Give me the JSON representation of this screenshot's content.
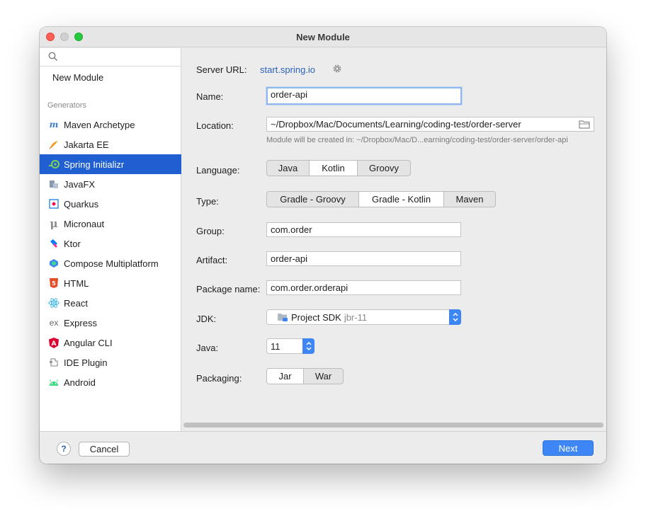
{
  "window": {
    "title": "New Module"
  },
  "sidebar": {
    "search_placeholder": "",
    "new_module": "New Module",
    "generators_label": "Generators",
    "items": [
      {
        "label": "Maven Archetype",
        "icon": "maven-icon",
        "selected": false
      },
      {
        "label": "Jakarta EE",
        "icon": "jakarta-icon",
        "selected": false
      },
      {
        "label": "Spring Initializr",
        "icon": "spring-icon",
        "selected": true
      },
      {
        "label": "JavaFX",
        "icon": "javafx-icon",
        "selected": false
      },
      {
        "label": "Quarkus",
        "icon": "quarkus-icon",
        "selected": false
      },
      {
        "label": "Micronaut",
        "icon": "micronaut-icon",
        "selected": false
      },
      {
        "label": "Ktor",
        "icon": "ktor-icon",
        "selected": false
      },
      {
        "label": "Compose Multiplatform",
        "icon": "compose-icon",
        "selected": false
      },
      {
        "label": "HTML",
        "icon": "html5-icon",
        "selected": false
      },
      {
        "label": "React",
        "icon": "react-icon",
        "selected": false
      },
      {
        "label": "Express",
        "icon": "express-icon",
        "selected": false
      },
      {
        "label": "Angular CLI",
        "icon": "angular-icon",
        "selected": false
      },
      {
        "label": "IDE Plugin",
        "icon": "plugin-icon",
        "selected": false
      },
      {
        "label": "Android",
        "icon": "android-icon",
        "selected": false
      }
    ]
  },
  "form": {
    "server_url_label": "Server URL:",
    "server_url_value": "start.spring.io",
    "name_label": "Name:",
    "name_value": "order-api",
    "location_label": "Location:",
    "location_value": "~/Dropbox/Mac/Documents/Learning/coding-test/order-server",
    "location_hint": "Module will be created in: ~/Dropbox/Mac/D...earning/coding-test/order-server/order-api",
    "language_label": "Language:",
    "language_options": [
      "Java",
      "Kotlin",
      "Groovy"
    ],
    "language_selected": "Kotlin",
    "type_label": "Type:",
    "type_options": [
      "Gradle - Groovy",
      "Gradle - Kotlin",
      "Maven"
    ],
    "type_selected": "Gradle - Kotlin",
    "group_label": "Group:",
    "group_value": "com.order",
    "artifact_label": "Artifact:",
    "artifact_value": "order-api",
    "package_label": "Package name:",
    "package_value": "com.order.orderapi",
    "jdk_label": "JDK:",
    "jdk_name": "Project SDK",
    "jdk_version": "jbr-11",
    "java_label": "Java:",
    "java_value": "11",
    "packaging_label": "Packaging:",
    "packaging_options": [
      "Jar",
      "War"
    ],
    "packaging_selected": "Jar"
  },
  "footer": {
    "help": "?",
    "cancel": "Cancel",
    "next": "Next"
  },
  "colors": {
    "selection": "#1f5fd1",
    "link": "#2a62b8",
    "primary_button": "#3d86f4"
  }
}
